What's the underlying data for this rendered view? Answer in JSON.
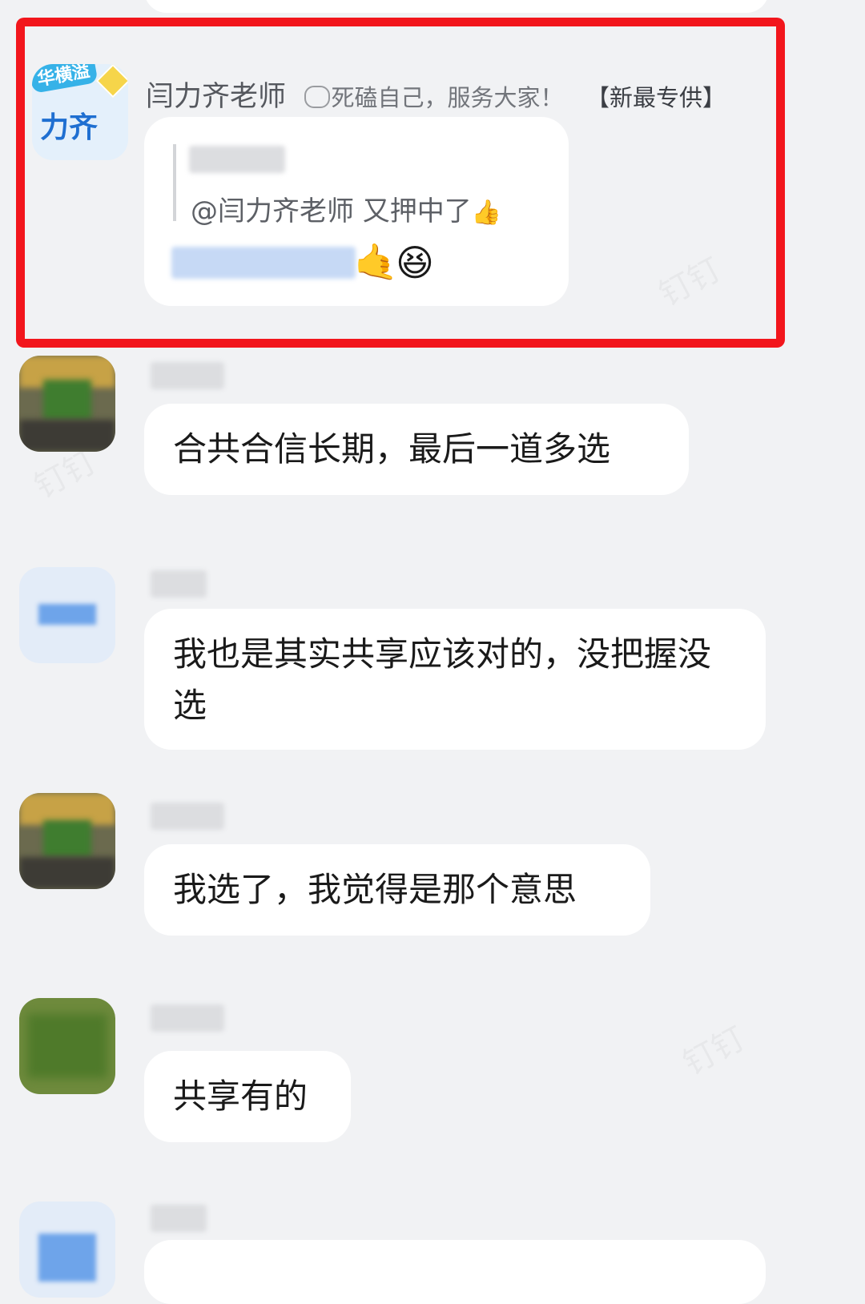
{
  "highlight_color": "#f2161c",
  "featured_message": {
    "avatar_badge": "华横溢",
    "avatar_name": "力齐",
    "sender_name": "闫力齐老师",
    "signature_icon": "speech-bubble-icon",
    "signature": "死磕自己，服务大家！",
    "tag": "【新最专供】",
    "quote_text": "@闫力齐老师 又押中了",
    "quote_emoji": "👍",
    "reply_emojis": [
      "🤙",
      "😆"
    ]
  },
  "messages": [
    {
      "text": "合共合信长期，最后一道多选"
    },
    {
      "text": "我也是其实共享应该对的，没把握没选"
    },
    {
      "text": "我选了，我觉得是那个意思"
    },
    {
      "text": "共享有的"
    }
  ]
}
